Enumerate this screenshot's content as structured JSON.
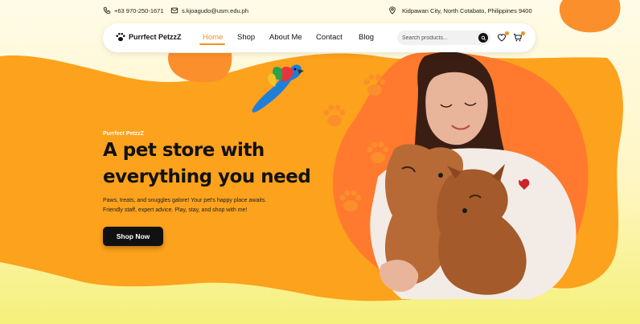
{
  "contact": {
    "phone": "+63 970-250-1671",
    "email": "s.kjoagudo@usm.edu.ph",
    "address": "Kidpawan City, North Cotabato, Philippines 9400"
  },
  "brand": {
    "name": "Purrfect PetzzZ"
  },
  "nav": {
    "items": [
      {
        "label": "Home",
        "active": true
      },
      {
        "label": "Shop"
      },
      {
        "label": "About Me"
      },
      {
        "label": "Contact"
      },
      {
        "label": "Blog"
      }
    ]
  },
  "search": {
    "placeholder": "Search products..."
  },
  "hero": {
    "eyebrow": "Purrfect PetzzZ",
    "headline_line1": "A pet store with",
    "headline_line2": "everything you need",
    "sub_line1": "Paws, treats, and snuggles galore! Your pet's happy place awaits.",
    "sub_line2": "Friendly staff, expert advice. Play, stay, and shop with me!",
    "cta": "Shop Now"
  },
  "icons": [
    "phone-icon",
    "mail-icon",
    "location-icon",
    "paw-logo-icon",
    "search-icon",
    "heart-icon",
    "cart-icon",
    "paw-print-icon",
    "parrot-illustration"
  ],
  "colors": {
    "accent": "#f5911e",
    "orange": "#fca21c",
    "dark": "#111111",
    "blob": "#fb8f2b"
  }
}
